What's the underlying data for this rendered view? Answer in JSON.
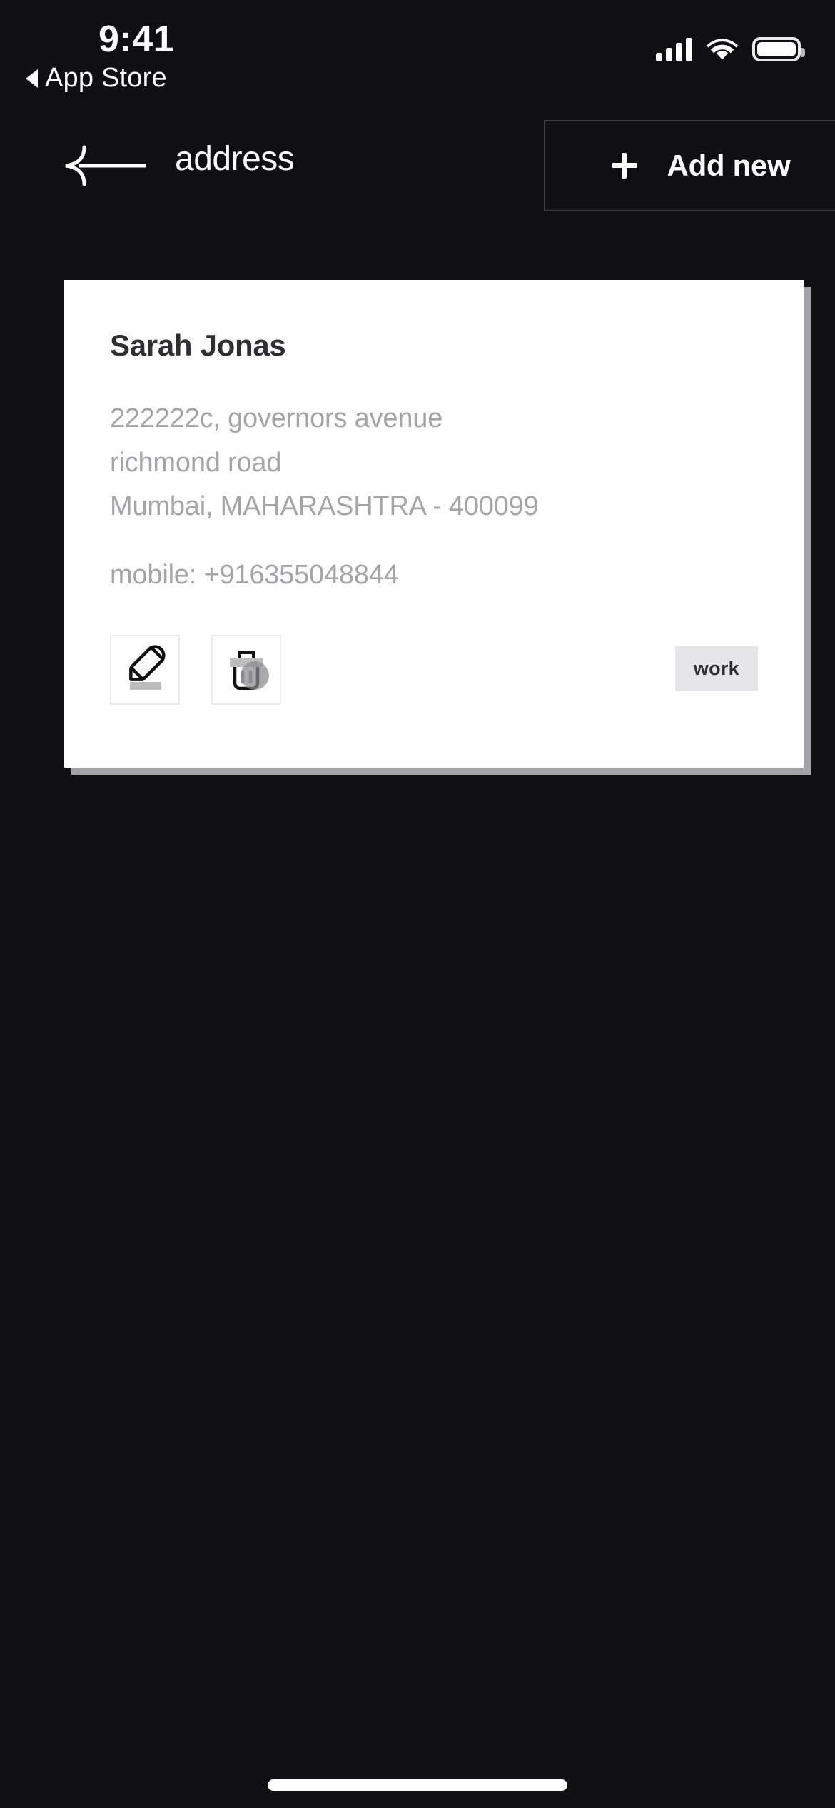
{
  "status_bar": {
    "time": "9:41",
    "back_app_label": "App Store",
    "back_triangle_icon": "triangle-left-icon",
    "cellular_icon": "cellular-signal-icon",
    "cellular_bars": 4,
    "wifi_icon": "wifi-icon",
    "battery_icon": "battery-full-icon"
  },
  "navbar": {
    "back_icon": "arrow-left-icon",
    "title": "address",
    "add_new": {
      "plus_icon": "plus-icon",
      "label": "Add new"
    }
  },
  "address_card": {
    "name": "Sarah Jonas",
    "address_lines": [
      "222222c, governors avenue",
      "richmond road",
      "Mumbai, MAHARASHTRA - 400099"
    ],
    "mobile": "mobile: +916355048844",
    "actions": [
      {
        "name": "edit-address-button",
        "icon": "pencil-icon"
      },
      {
        "name": "delete-address-button",
        "icon": "trash-icon"
      }
    ],
    "tag": "work"
  },
  "home_indicator": "home-indicator",
  "colors": {
    "background": "#100f12",
    "card": "#ffffff",
    "card_shadow": "#a3a3a7",
    "name_text": "#2f2f33",
    "muted_text": "#a5a5a9",
    "tag_bg": "#e6e6e8",
    "border": "#3e3e42",
    "accent": "#ffffff"
  }
}
